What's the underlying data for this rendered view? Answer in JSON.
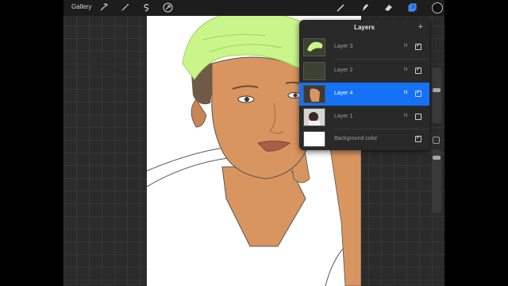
{
  "toolbar": {
    "gallery_label": "Gallery",
    "icons": [
      "wrench-icon",
      "magic-wand-icon",
      "selection-icon",
      "transform-arrow-icon",
      "brush-icon",
      "smudge-icon",
      "eraser-icon",
      "layers-icon"
    ],
    "accent": "#1572f5"
  },
  "layers_panel": {
    "title": "Layers",
    "add_symbol": "+",
    "layers": [
      {
        "name": "Layer 3",
        "mode": "N",
        "visible": true,
        "active": false
      },
      {
        "name": "Layer 2",
        "mode": "N",
        "visible": true,
        "active": false
      },
      {
        "name": "Layer 4",
        "mode": "N",
        "visible": true,
        "active": true
      },
      {
        "name": "Layer 1",
        "mode": "N",
        "visible": false,
        "active": false
      }
    ],
    "background": {
      "name": "Background color",
      "visible": true,
      "color": "#ffffff"
    }
  },
  "colors": {
    "hair": "#c9f58a",
    "skin": "#d9955f",
    "lips": "#a85e4a"
  }
}
